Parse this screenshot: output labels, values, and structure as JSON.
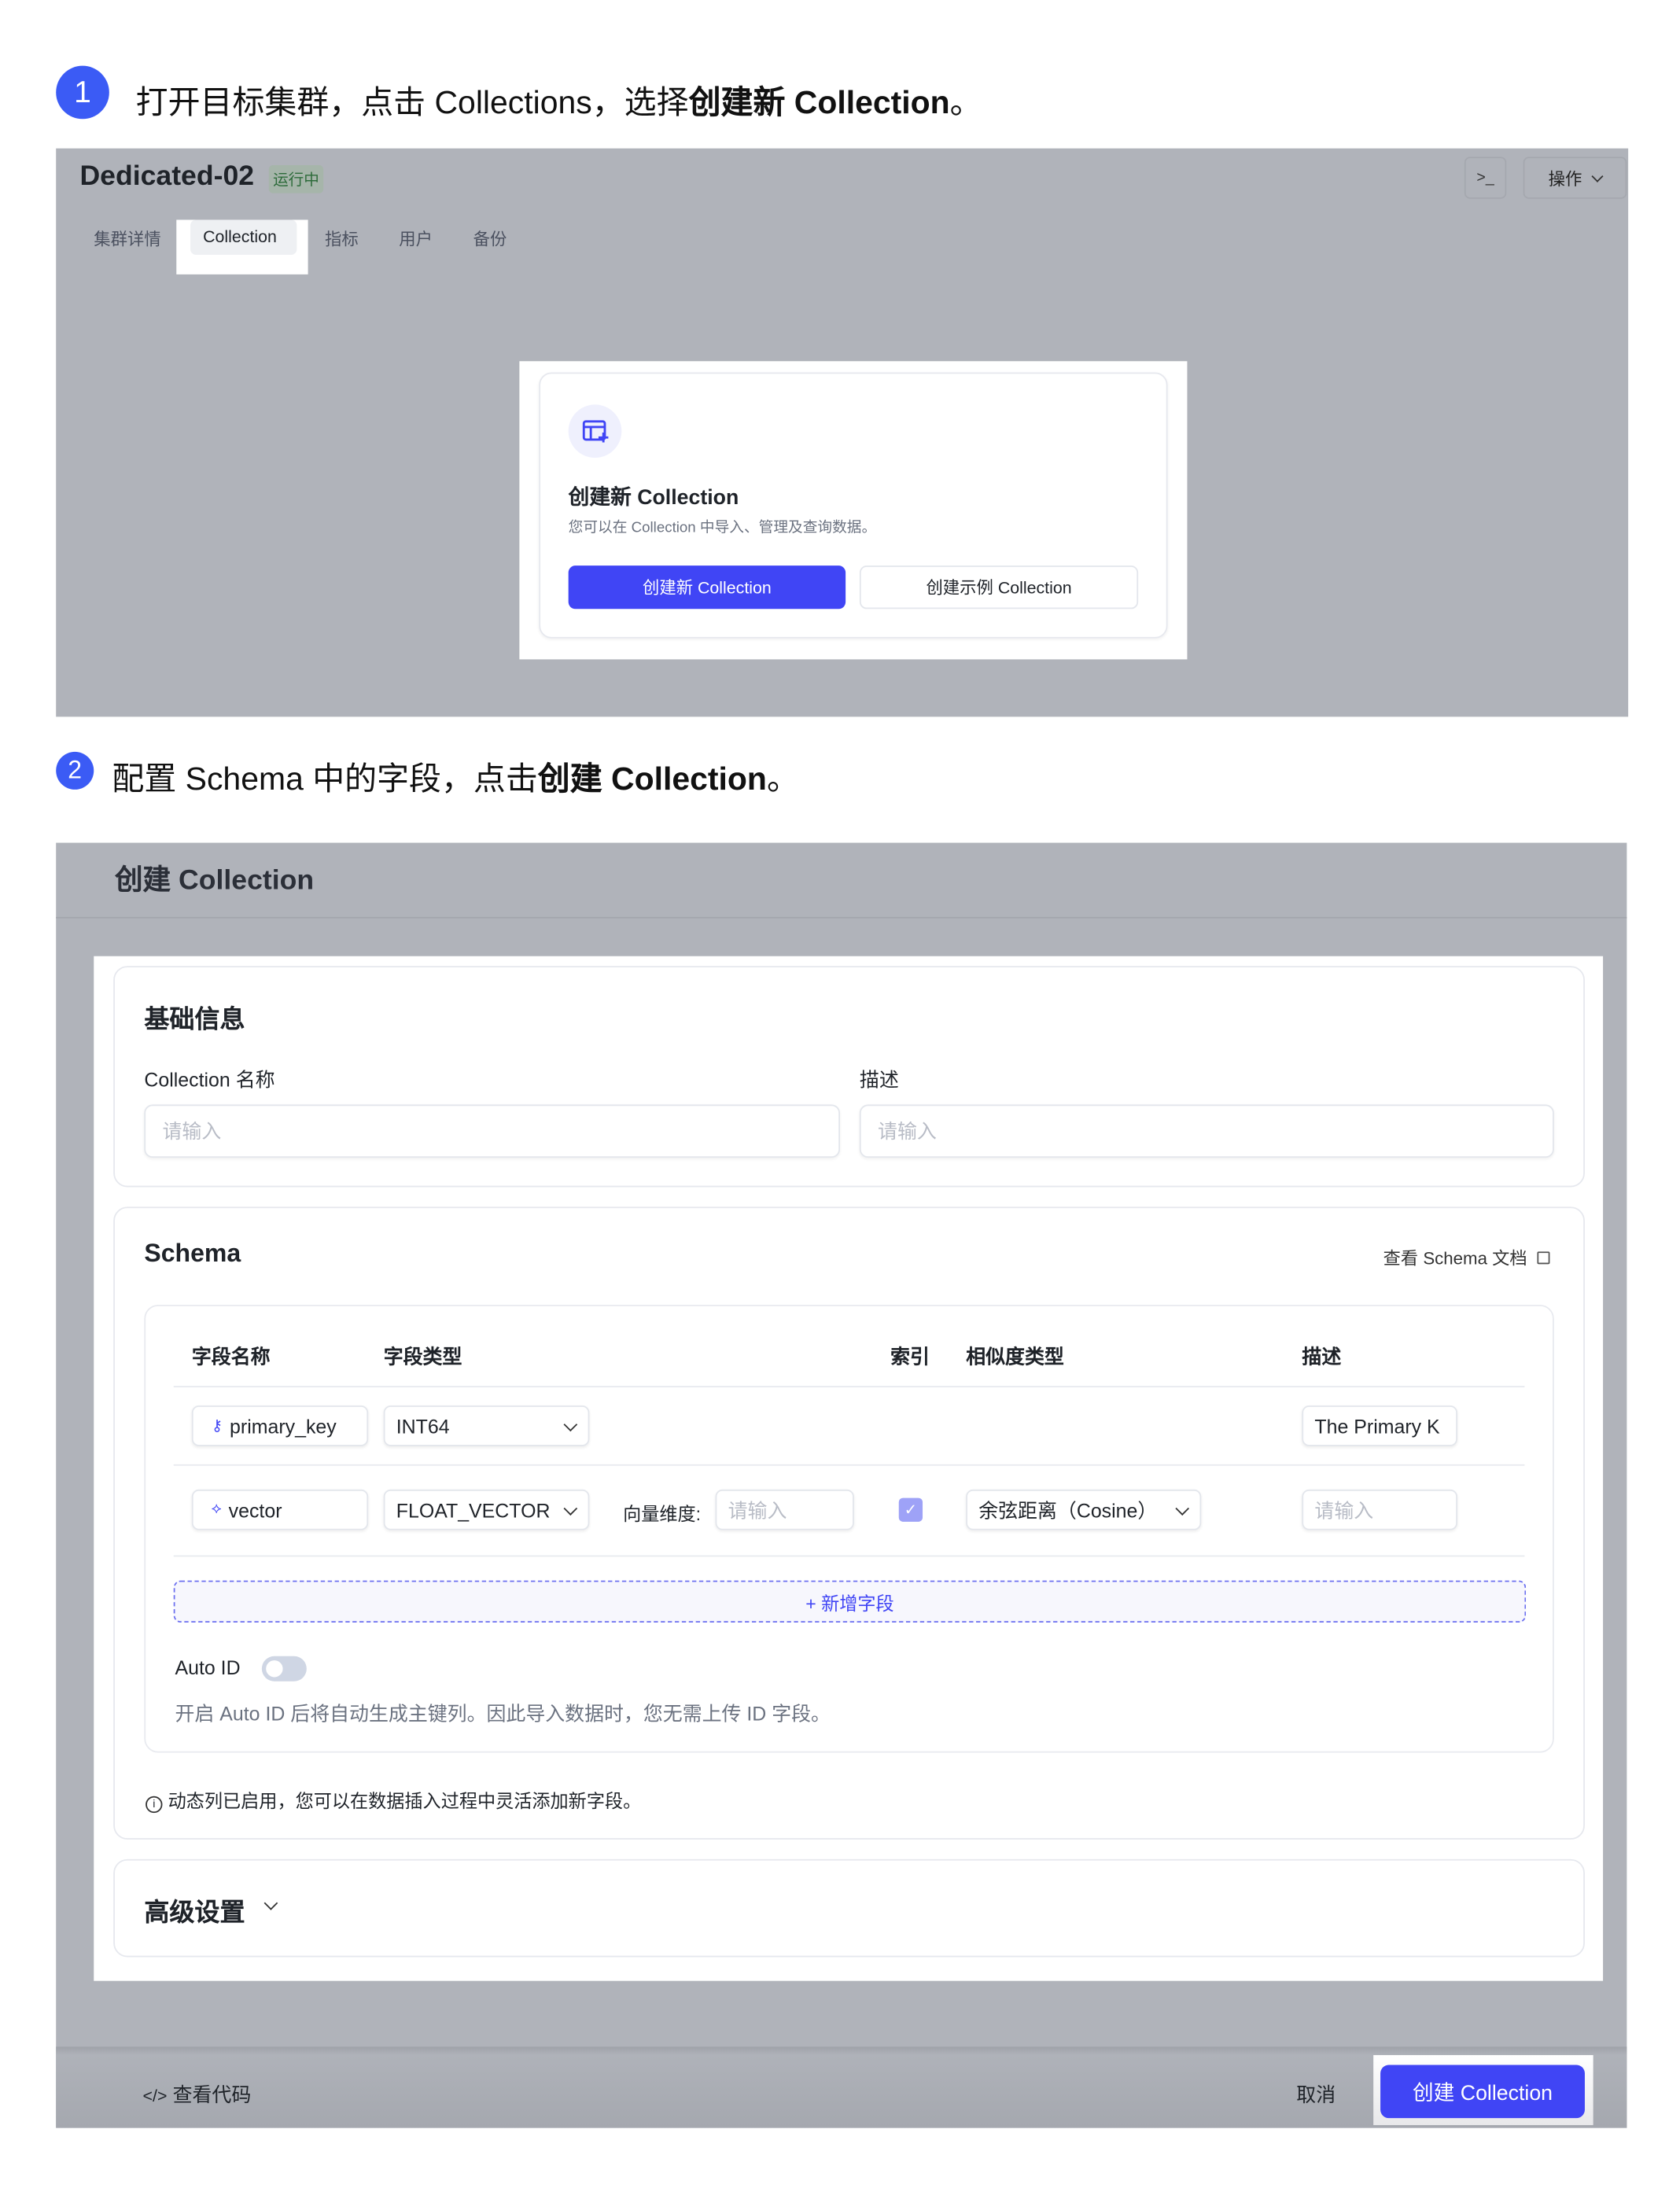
{
  "step1": {
    "number": "1",
    "text_plain": "打开目标集群，点击 Collections，选择",
    "text_bold": "创建新 Collection",
    "text_end": "。"
  },
  "step2": {
    "number": "2",
    "text_plain": "配置 Schema 中的字段，点击",
    "text_bold": "创建 Collection",
    "text_end": "。"
  },
  "cluster": {
    "name": "Dedicated-02",
    "status": "运行中",
    "terminal_label": ">_",
    "actions_label": "操作",
    "tabs": [
      "集群详情",
      "Collection",
      "指标",
      "用户",
      "备份"
    ],
    "active_tab": "Collection",
    "empty_card": {
      "title": "创建新 Collection",
      "subtitle": "您可以在 Collection 中导入、管理及查询数据。",
      "primary_button": "创建新 Collection",
      "secondary_button": "创建示例 Collection"
    }
  },
  "create": {
    "title": "创建 Collection",
    "basic": {
      "heading": "基础信息",
      "name_label": "Collection 名称",
      "name_placeholder": "请输入",
      "desc_label": "描述",
      "desc_placeholder": "请输入"
    },
    "schema": {
      "heading": "Schema",
      "doc_link": "查看 Schema 文档",
      "columns": [
        "字段名称",
        "字段类型",
        "索引",
        "相似度类型",
        "描述"
      ],
      "rows": [
        {
          "name": "primary_key",
          "type": "INT64",
          "description": "The Primary K"
        },
        {
          "name": "vector",
          "type": "FLOAT_VECTOR",
          "dim_label": "向量维度:",
          "dim_placeholder": "请输入",
          "index_checked": true,
          "metric": "余弦距离（Cosine）",
          "description_placeholder": "请输入"
        }
      ],
      "add_field": "+ 新增字段",
      "auto_id_label": "Auto ID",
      "auto_id_enabled": false,
      "auto_id_help": "开启 Auto ID 后将自动生成主键列。因此导入数据时，您无需上传 ID 字段。",
      "dynamic_note": "动态列已启用，您可以在数据插入过程中灵活添加新字段。"
    },
    "advanced": {
      "heading": "高级设置"
    },
    "footer": {
      "view_code": "查看代码",
      "cancel": "取消",
      "submit": "创建 Collection"
    }
  },
  "colors": {
    "accent": "#4045f5",
    "step": "#3b5bf5",
    "overlay": "#b0b3ba"
  }
}
